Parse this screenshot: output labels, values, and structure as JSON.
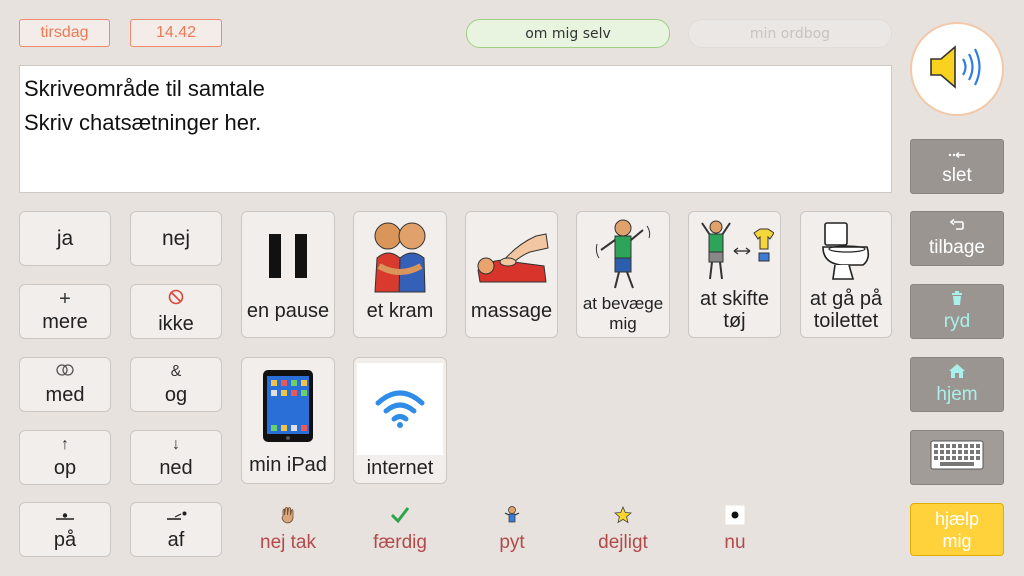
{
  "header": {
    "day": "tirsdag",
    "time": "14.42",
    "tab_about": "om mig selv",
    "tab_dictionary": "min ordbog"
  },
  "editor": {
    "line1": "Skriveområde til samtale",
    "line2": "Skriv chatsætninger her."
  },
  "words": {
    "yes": "ja",
    "no": "nej",
    "more": "mere",
    "not": "ikke",
    "with": "med",
    "and": "og",
    "up": "op",
    "down": "ned",
    "on": "på",
    "off": "af"
  },
  "glyphs": {
    "more": "+",
    "and": "&",
    "up": "↑",
    "down": "↓"
  },
  "pictures": {
    "pause": "en pause",
    "hug": "et kram",
    "massage": "massage",
    "move_line1": "at bevæge",
    "move_line2": "mig",
    "change_line1": "at skifte",
    "change_line2": "tøj",
    "toilet_line1": "at gå på",
    "toilet_line2": "toilettet",
    "ipad": "min iPad",
    "internet": "internet"
  },
  "quick": {
    "no_thanks": "nej tak",
    "done": "færdig",
    "whatever": "pyt",
    "lovely": "dejligt",
    "now": "nu"
  },
  "sidebar": {
    "delete": "slet",
    "back": "tilbage",
    "clear": "ryd",
    "home": "hjem",
    "help_line1": "hjælp",
    "help_line2": "mig"
  },
  "icons": {
    "speaker": "speaker-icon",
    "keyboard": "keyboard-icon"
  },
  "colors": {
    "background": "#e8e2df",
    "quick_text": "#b24a4a",
    "help": "#ffd23b",
    "sidebar_button": "#9b9592"
  }
}
